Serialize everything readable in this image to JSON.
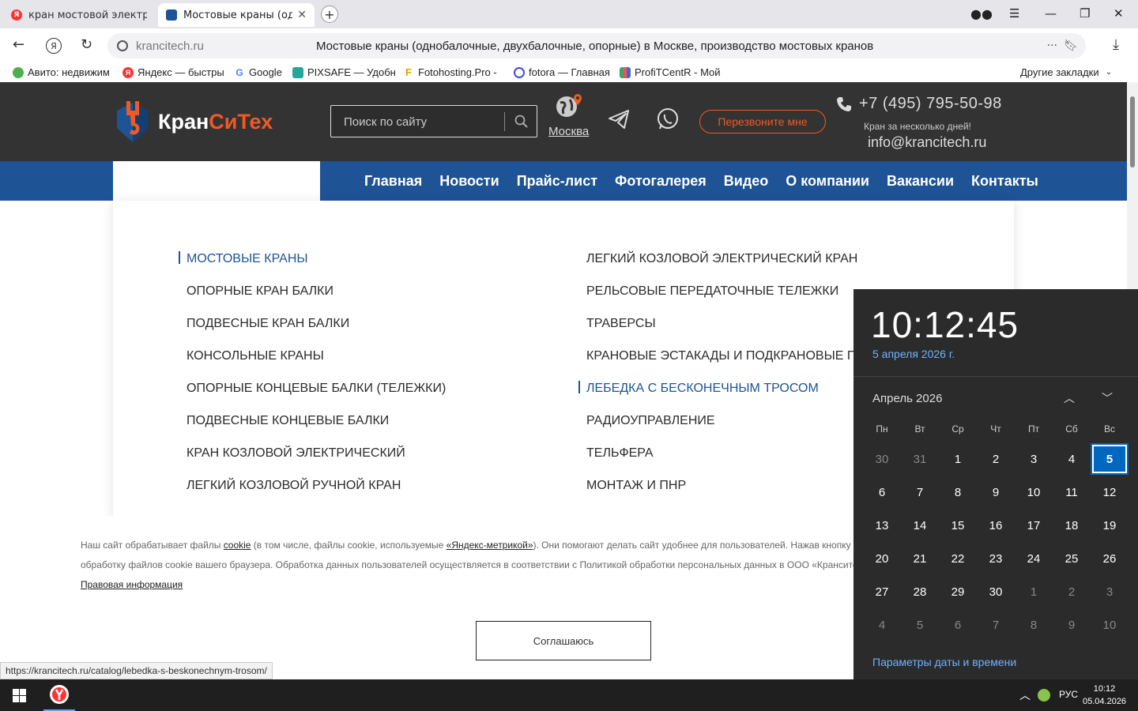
{
  "browser": {
    "tabs": [
      {
        "title": "кран мостовой электриче",
        "favicon": "yandex-icon"
      },
      {
        "title": "Мостовые краны (одно",
        "favicon": "krancitech-icon"
      }
    ],
    "new_tab": "+",
    "address": {
      "domain": "krancitech.ru",
      "page_title": "Мостовые краны (однобалочные, двухбалочные, опорные) в Москве, производство мостовых кранов",
      "menu": "···"
    },
    "bookmarks": [
      {
        "label": "Авито: недвижим",
        "icon": "avito-icon",
        "color": "#4caf50"
      },
      {
        "label": "Яндекс — быстры",
        "icon": "yandex-icon",
        "color": "#f33"
      },
      {
        "label": "Google",
        "icon": "google-icon",
        "color": "#4285f4"
      },
      {
        "label": "PIXSAFE — Удобн",
        "icon": "pixsafe-icon",
        "color": "#26a69a"
      },
      {
        "label": "Fotohosting.Pro - ",
        "icon": "fotohosting-icon",
        "color": "#e6a100"
      },
      {
        "label": "fotora — Главная",
        "icon": "fotora-icon",
        "color": "#3b4fd8"
      },
      {
        "label": "ProfiTCentR - Мой",
        "icon": "profitcentr-icon",
        "color": "#d77"
      }
    ],
    "other_bookmarks": "Другие закладки",
    "status_url": "https://krancitech.ru/catalog/lebedka-s-beskonechnym-trosom/"
  },
  "header": {
    "logo_part1": "Кран",
    "logo_part2": "СиТех",
    "search_placeholder": "Поиск по сайту",
    "city": "Москва",
    "callback": "Перезвоните мне",
    "phone": "+7 (495) 795-50-98",
    "tagline": "Кран за несколько дней!",
    "email": "info@krancitech.ru"
  },
  "nav": [
    "Главная",
    "Новости",
    "Прайс-лист",
    "Фотогалерея",
    "Видео",
    "О компании",
    "Вакансии",
    "Контакты"
  ],
  "menu": {
    "left": [
      {
        "label": "МОСТОВЫЕ КРАНЫ",
        "highlight": true
      },
      {
        "label": "ОПОРНЫЕ КРАН БАЛКИ",
        "highlight": false
      },
      {
        "label": "ПОДВЕСНЫЕ КРАН БАЛКИ",
        "highlight": false
      },
      {
        "label": "КОНСОЛЬНЫЕ КРАНЫ",
        "highlight": false
      },
      {
        "label": "ОПОРНЫЕ КОНЦЕВЫЕ БАЛКИ (ТЕЛЕЖКИ)",
        "highlight": false
      },
      {
        "label": "ПОДВЕСНЫЕ КОНЦЕВЫЕ БАЛКИ",
        "highlight": false
      },
      {
        "label": "КРАН КОЗЛОВОЙ ЭЛЕКТРИЧЕСКИЙ",
        "highlight": false
      },
      {
        "label": "ЛЕГКИЙ КОЗЛОВОЙ РУЧНОЙ КРАН",
        "highlight": false
      }
    ],
    "right": [
      {
        "label": "ЛЕГКИЙ КОЗЛОВОЙ ЭЛЕКТРИЧЕСКИЙ КРАН",
        "highlight": false
      },
      {
        "label": "РЕЛЬСОВЫЕ ПЕРЕДАТОЧНЫЕ ТЕЛЕЖКИ",
        "highlight": false
      },
      {
        "label": "ТРАВЕРСЫ",
        "highlight": false
      },
      {
        "label": "КРАНОВЫЕ ЭСТАКАДЫ И ПОДКРАНОВЫЕ ПУ",
        "highlight": false
      },
      {
        "label": "ЛЕБЕДКА С БЕСКОНЕЧНЫМ ТРОСОМ",
        "highlight": true
      },
      {
        "label": "РАДИОУПРАВЛЕНИЕ",
        "highlight": false
      },
      {
        "label": "ТЕЛЬФЕРА",
        "highlight": false
      },
      {
        "label": "МОНТАЖ И ПНР",
        "highlight": false
      }
    ]
  },
  "cookie": {
    "l1_a": "Наш сайт обрабатывает файлы ",
    "l1_b": "cookie",
    "l1_c": " (в том числе, файлы cookie, используемые ",
    "l1_d": "«Яндекс-метрикой»",
    "l1_e": "). Они помогают делать сайт удобнее для пользователей. Нажав кнопку",
    "l2": "обработку файлов cookie вашего браузера. Обработка данных пользователей осуществляется в соответствии с Политикой обработки персональных данных в ООО «Кранситех»",
    "legal": "Правовая информация",
    "agree": "Соглашаюсь"
  },
  "calendar": {
    "time": "10:12:45",
    "date": "5 апреля 2026 г.",
    "month": "Апрель 2026",
    "dows": [
      "Пн",
      "Вт",
      "Ср",
      "Чт",
      "Пт",
      "Сб",
      "Вс"
    ],
    "weeks": [
      [
        "30",
        "31",
        "1",
        "2",
        "3",
        "4",
        "5"
      ],
      [
        "6",
        "7",
        "8",
        "9",
        "10",
        "11",
        "12"
      ],
      [
        "13",
        "14",
        "15",
        "16",
        "17",
        "18",
        "19"
      ],
      [
        "20",
        "21",
        "22",
        "23",
        "24",
        "25",
        "26"
      ],
      [
        "27",
        "28",
        "29",
        "30",
        "1",
        "2",
        "3"
      ],
      [
        "4",
        "5",
        "6",
        "7",
        "8",
        "9",
        "10"
      ]
    ],
    "today": "5",
    "settings": "Параметры даты и времени"
  },
  "taskbar": {
    "lang": "РУС",
    "time": "10:12",
    "date": "05.04.2026"
  }
}
